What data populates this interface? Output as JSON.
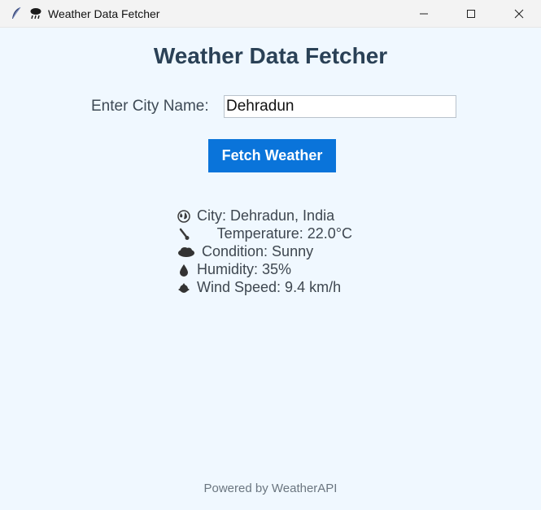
{
  "window": {
    "title": "Weather Data Fetcher",
    "icons": [
      "feather-icon",
      "storm-cloud-icon"
    ],
    "controls": [
      "minimize",
      "maximize",
      "close"
    ]
  },
  "app": {
    "heading": "Weather Data Fetcher",
    "city_label": "Enter City Name:",
    "city_value": "Dehradun",
    "fetch_button": "Fetch Weather",
    "results": {
      "city": "City: Dehradun, India",
      "temperature": "     Temperature: 22.0°C",
      "condition": "Condition: Sunny",
      "humidity": "Humidity: 35%",
      "wind": "Wind Speed: 9.4 km/h"
    },
    "footer": "Powered by WeatherAPI"
  },
  "colors": {
    "background": "#f0f8ff",
    "button": "#0a74da",
    "heading": "#2a4156"
  }
}
